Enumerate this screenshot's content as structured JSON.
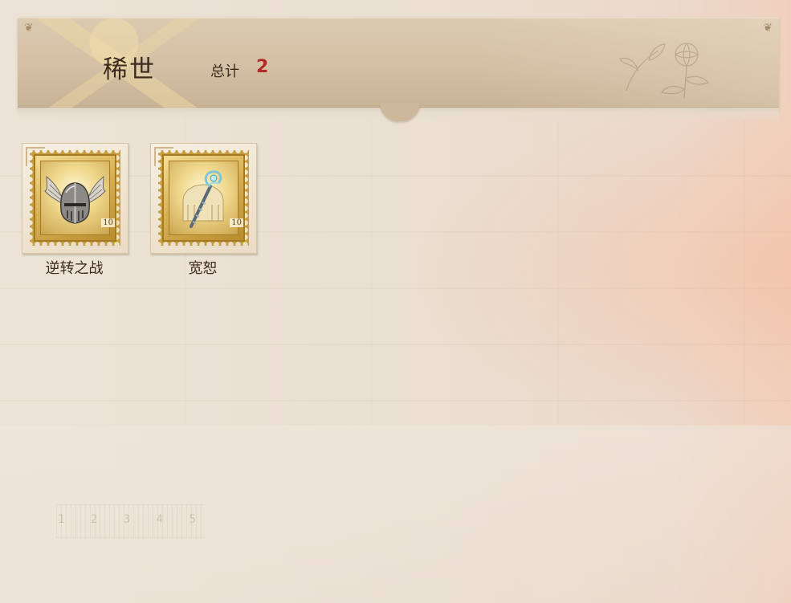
{
  "header": {
    "title": "稀世",
    "total_label": "总计",
    "total_count": "2"
  },
  "stamps": [
    {
      "name": "逆转之战",
      "icon": "winged-helmet-icon",
      "value_text": "10"
    },
    {
      "name": "宽恕",
      "icon": "crystal-staff-icon",
      "value_text": "10"
    }
  ],
  "background": {
    "ruler_numbers": "1 2 3 4 5"
  },
  "colors": {
    "header_bg": "#d3bfa3",
    "title_text": "#3d2b1d",
    "count_text": "#b02a2a",
    "stamp_gold": "#c69d3f",
    "page_bg": "#eadfd1"
  }
}
